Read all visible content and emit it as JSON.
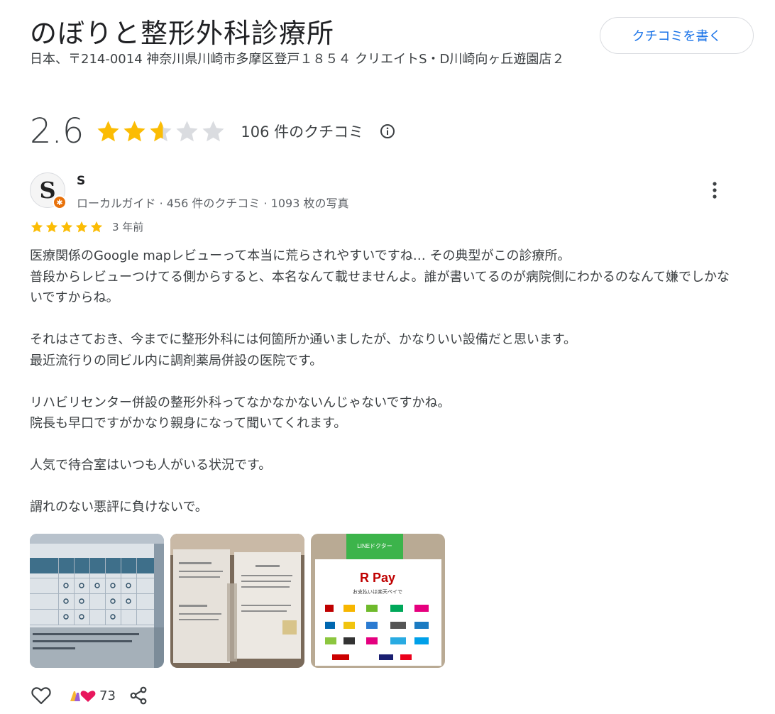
{
  "place": {
    "name": "のぼりと整形外科診療所",
    "address": "日本、〒214-0014 神奈川県川崎市多摩区登戸１８５４ クリエイトS・D川崎向ヶ丘遊園店２",
    "write_review_label": "クチコミを書く"
  },
  "rating": {
    "value": "2.6",
    "stars": 2.6,
    "review_count_label": "106 件のクチコミ"
  },
  "review": {
    "author": "S",
    "avatar_letter": "S",
    "meta": "ローカルガイド · 456 件のクチコミ · 1093 枚の写真",
    "stars": 5,
    "date": "3 年前",
    "paragraphs": [
      "医療関係のGoogle mapレビューって本当に荒らされやすいですね… その典型がこの診療所。\n普段からレビューつけてる側からすると、本名なんて載せませんよ。誰が書いてるのが病院側にわかるのなんて嫌でしかないですからね。",
      "それはさておき、今までに整形外科には何箇所か通いましたが、かなりいい設備だと思います。\n最近流行りの同ビル内に調剤薬局併設の医院です。",
      "リハビリセンター併設の整形外科ってなかなかないんじゃないですかね。\n院長も早口ですがかなり親身になって聞いてくれます。",
      "人気で待合室はいつも人がいる状況です。",
      "謂れのない悪評に負けないで。"
    ],
    "photos": [
      {
        "name": "photo-schedule-sign"
      },
      {
        "name": "photo-notice-signs"
      },
      {
        "name": "photo-payment-sign",
        "banner": "LINEドクター",
        "brand": "Pay",
        "subtitle": "お支払いは楽天ペイで"
      }
    ],
    "reaction_count": "73"
  },
  "colors": {
    "star": "#fbbc04",
    "star_empty": "#dadce0",
    "link": "#1a73e8",
    "text_secondary": "#5f6368"
  }
}
